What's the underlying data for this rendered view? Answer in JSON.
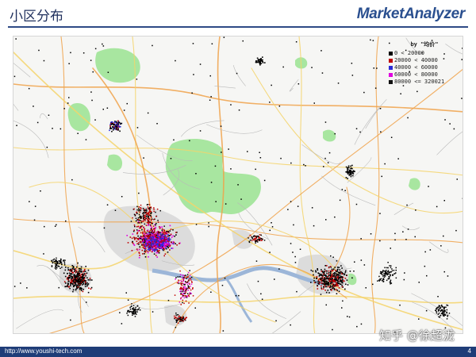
{
  "slide": {
    "title": "小区分布",
    "logo": "MarketAnalyzer",
    "page_number": "4"
  },
  "footer": {
    "url": "http://www.youshi-tech.com"
  },
  "watermark": {
    "text": "知乎 @徐超泷"
  },
  "colors": {
    "header_rule": "#2e4a86",
    "footer_bar": "#1f3d78",
    "road_orange": "#f0a24a",
    "road_yellow": "#f4d46a",
    "green_area": "#a8e6a0",
    "urban_gray": "#d8d8d8",
    "water": "#9cb6d8"
  },
  "legend": {
    "title": "by \"均价\"",
    "items": [
      {
        "label": "0 < 20000",
        "color": "#000000"
      },
      {
        "label": "20000 < 40000",
        "color": "#c00000"
      },
      {
        "label": "40000 < 60000",
        "color": "#2b2bd6"
      },
      {
        "label": "60000 < 80000",
        "color": "#e000e0"
      },
      {
        "label": "80000 <= 320021",
        "color": "#111111"
      }
    ]
  }
}
